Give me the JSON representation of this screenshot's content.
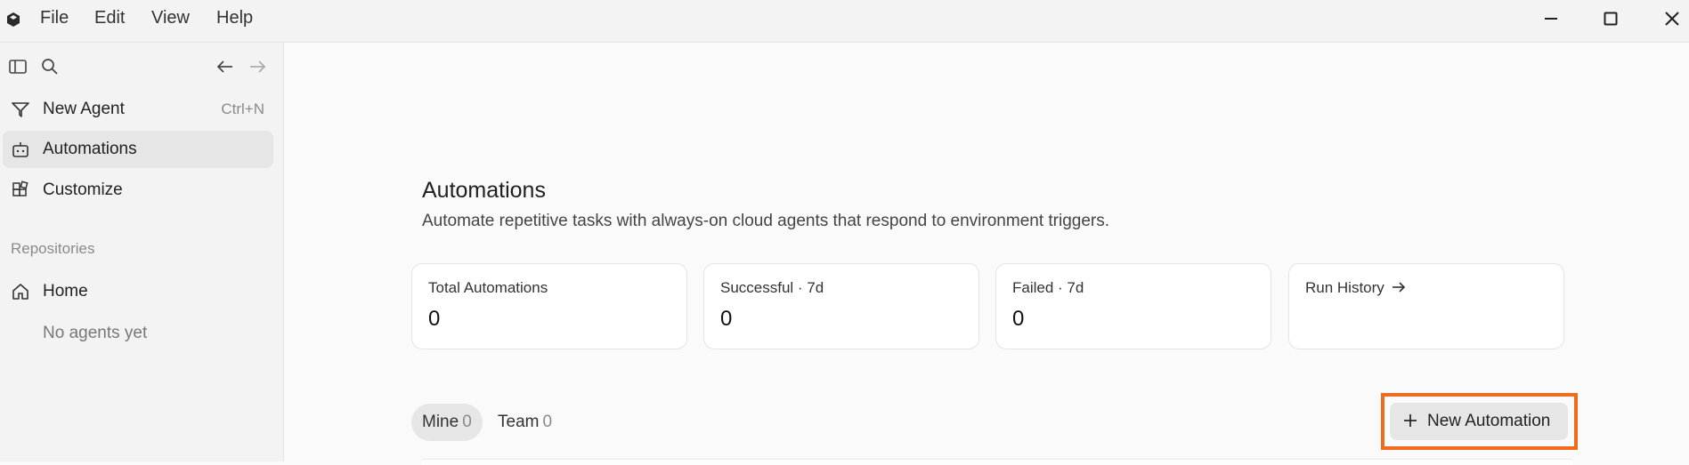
{
  "menubar": {
    "items": [
      "File",
      "Edit",
      "View",
      "Help"
    ]
  },
  "sidebar": {
    "items": [
      {
        "label": "New Agent",
        "shortcut": "Ctrl+N",
        "icon": "agent-funnel-icon"
      },
      {
        "label": "Automations",
        "icon": "robot-icon",
        "active": true
      },
      {
        "label": "Customize",
        "icon": "blocks-icon"
      }
    ],
    "section_label": "Repositories",
    "home_label": "Home",
    "empty_label": "No agents yet"
  },
  "main": {
    "title": "Automations",
    "subtitle": "Automate repetitive tasks with always-on cloud agents that respond to environment triggers.",
    "stats": [
      {
        "label": "Total Automations",
        "value": "0"
      },
      {
        "label": "Successful · 7d",
        "value": "0"
      },
      {
        "label": "Failed · 7d",
        "value": "0"
      },
      {
        "label": "Run History",
        "value": ""
      }
    ],
    "tabs": [
      {
        "label": "Mine",
        "count": "0",
        "active": true
      },
      {
        "label": "Team",
        "count": "0"
      }
    ],
    "new_button_label": "New Automation"
  },
  "colors": {
    "highlight": "#f26a1b",
    "active_bg": "#e6e6e6",
    "sidebar_bg": "#f3f3f3"
  }
}
